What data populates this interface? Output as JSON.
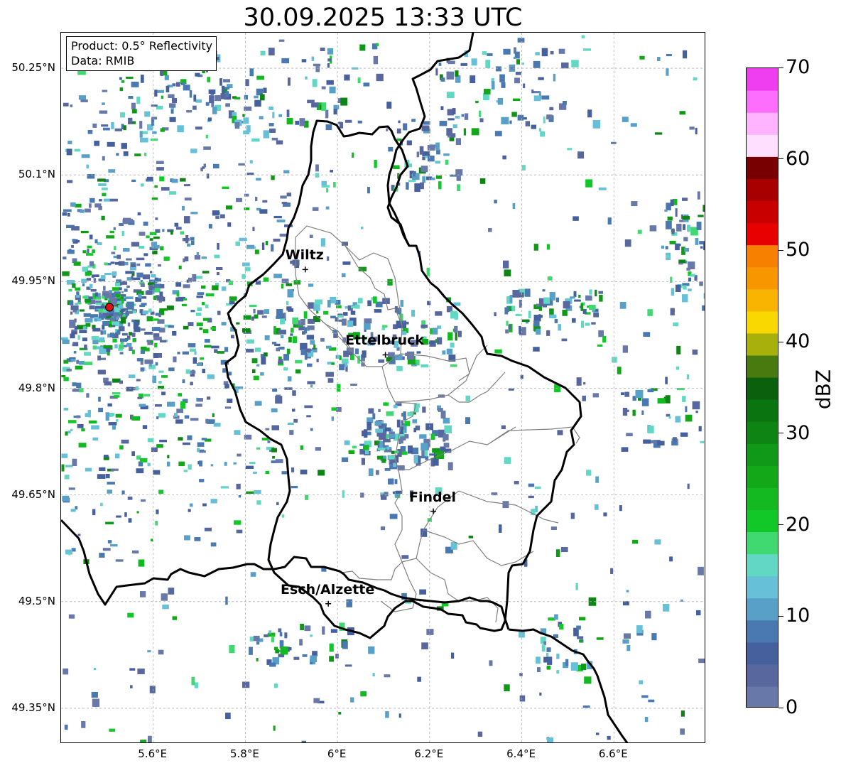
{
  "title": "30.09.2025 13:33 UTC",
  "info_box": {
    "product": "Product: 0.5° Reflectivity",
    "data_source": "Data: RMIB"
  },
  "map": {
    "lon_range": [
      5.4,
      6.8
    ],
    "lat_range": [
      49.3,
      50.3
    ],
    "lat_ticks": [
      {
        "value": 50.25,
        "label": "50.25°N"
      },
      {
        "value": 50.1,
        "label": "50.1°N"
      },
      {
        "value": 49.95,
        "label": "49.95°N"
      },
      {
        "value": 49.8,
        "label": "49.8°N"
      },
      {
        "value": 49.65,
        "label": "49.65°N"
      },
      {
        "value": 49.5,
        "label": "49.5°N"
      },
      {
        "value": 49.35,
        "label": "49.35°N"
      }
    ],
    "lon_ticks": [
      {
        "value": 5.6,
        "label": "5.6°E"
      },
      {
        "value": 5.8,
        "label": "5.8°E"
      },
      {
        "value": 6.0,
        "label": "6°E"
      },
      {
        "value": 6.2,
        "label": "6.2°E"
      },
      {
        "value": 6.4,
        "label": "6.4°E"
      },
      {
        "value": 6.6,
        "label": "6.6°E"
      }
    ],
    "cities": [
      {
        "name": "Wiltz",
        "lon": 5.93,
        "lat": 49.967
      },
      {
        "name": "Ettelbruck",
        "lon": 6.104,
        "lat": 49.847
      },
      {
        "name": "Findel",
        "lon": 6.208,
        "lat": 49.627
      },
      {
        "name": "Esch/Alzette",
        "lon": 5.98,
        "lat": 49.497
      }
    ],
    "radar_site": {
      "lon": 5.505,
      "lat": 49.914,
      "color": "#dd1111"
    }
  },
  "colorbar": {
    "label": "dBZ",
    "min": 0,
    "max": 70,
    "ticks": [
      {
        "value": 0,
        "label": "0"
      },
      {
        "value": 10,
        "label": "10"
      },
      {
        "value": 20,
        "label": "20"
      },
      {
        "value": 30,
        "label": "30"
      },
      {
        "value": 40,
        "label": "40"
      },
      {
        "value": 50,
        "label": "50"
      },
      {
        "value": 60,
        "label": "60"
      },
      {
        "value": 70,
        "label": "70"
      }
    ],
    "colors": [
      "#6878a8",
      "#58689e",
      "#46609e",
      "#4a78b0",
      "#58a0c8",
      "#66c0d8",
      "#62d8c4",
      "#40d870",
      "#12c828",
      "#14b820",
      "#12a818",
      "#109818",
      "#0e8414",
      "#0a7410",
      "#0a600c",
      "#487a10",
      "#a8b00c",
      "#f8d800",
      "#f8b400",
      "#f89600",
      "#f88000",
      "#e80000",
      "#c80000",
      "#a80000",
      "#780000",
      "#fee0fe",
      "#feb4fe",
      "#fe6efe",
      "#ee3ef0"
    ]
  }
}
